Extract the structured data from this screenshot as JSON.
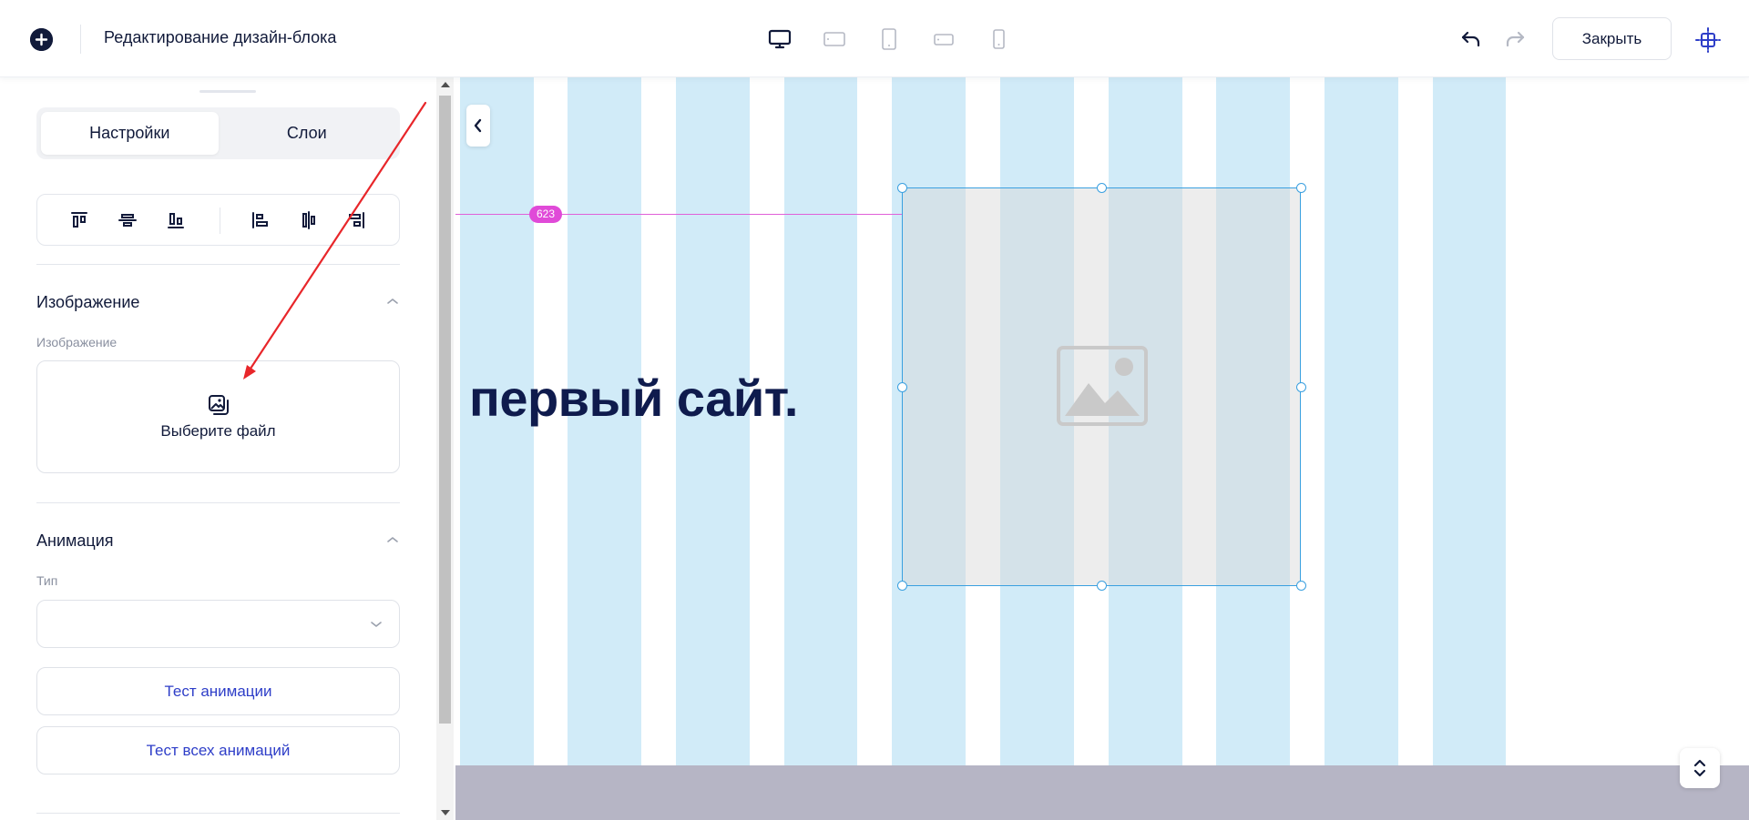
{
  "header": {
    "title": "Редактирование дизайн-блока",
    "close_label": "Закрыть",
    "devices": [
      "desktop-icon",
      "tablet-landscape-icon",
      "tablet-portrait-icon",
      "phone-landscape-icon",
      "phone-portrait-icon"
    ],
    "active_device": "desktop-icon"
  },
  "panel": {
    "tabs": [
      "Настройки",
      "Слои"
    ],
    "active_tab": "Настройки",
    "image_section": {
      "title": "Изображение",
      "field_label": "Изображение",
      "file_button": "Выберите файл"
    },
    "animation_section": {
      "title": "Анимация",
      "type_label": "Тип",
      "type_value": "",
      "test_button": "Тест анимации",
      "test_all_button": "Тест всех анимаций"
    }
  },
  "canvas": {
    "hero_text": "первый сайт.",
    "distance_badge": "623",
    "colors": {
      "column": "#d1ebf8",
      "guide": "#e060d8",
      "selection": "#3aa0e0",
      "bottom_band": "#b6b5c5",
      "accent": "#2e3ec8"
    }
  }
}
